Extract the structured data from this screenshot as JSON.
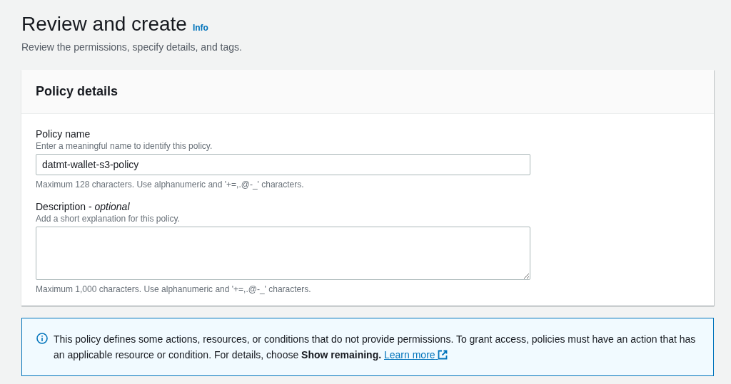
{
  "header": {
    "title": "Review and create",
    "info_link": "Info",
    "description": "Review the permissions, specify details, and tags."
  },
  "policy_details": {
    "title": "Policy details",
    "fields": [
      {
        "kind": "input",
        "label": "Policy name",
        "hint": "Enter a meaningful name to identify this policy.",
        "value": "datmt-wallet-s3-policy",
        "constraint": "Maximum 128 characters. Use alphanumeric and '+=,.@-_' characters."
      },
      {
        "kind": "textarea",
        "label": "Description - *optional*",
        "hint": "Add a short explanation for this policy.",
        "constraint": "Maximum 1,000 characters. Use alphanumeric and '+=,.@-_' characters."
      }
    ]
  },
  "alert": {
    "text": "This policy defines some actions, resources, or conditions that do not provide permissions. To grant access, policies must have an action that has an applicable resource or condition. For details, choose **Show remaining.**",
    "link": "Learn more"
  }
}
